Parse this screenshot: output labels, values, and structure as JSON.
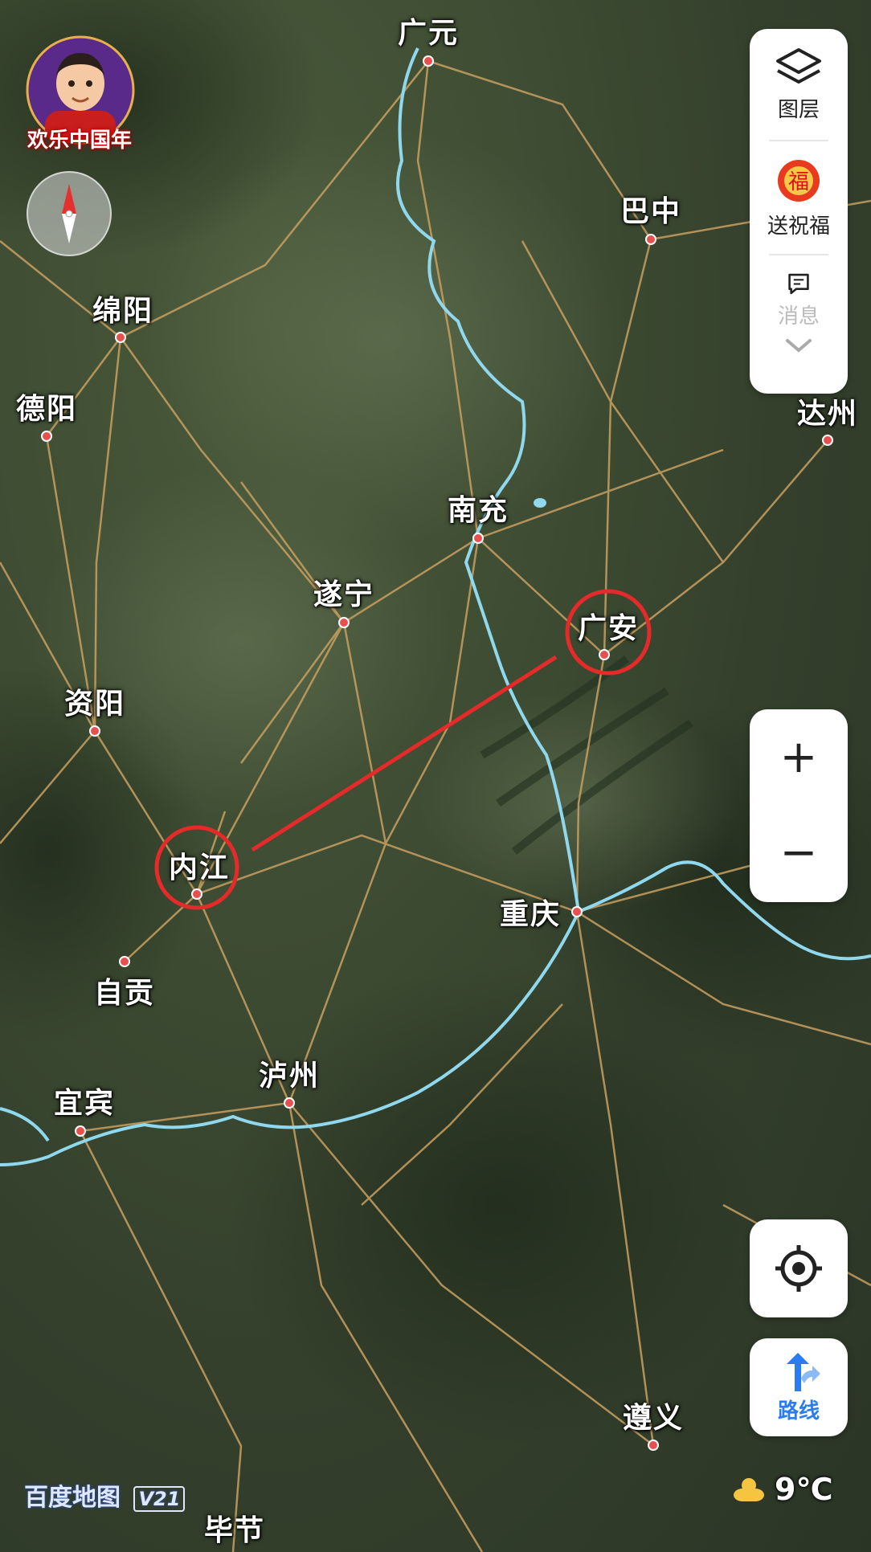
{
  "map": {
    "cities": [
      {
        "id": "guangyuan",
        "name": "广元"
      },
      {
        "id": "bazhong",
        "name": "巴中"
      },
      {
        "id": "mianyang",
        "name": "绵阳"
      },
      {
        "id": "deyang",
        "name": "德阳"
      },
      {
        "id": "dazhou",
        "name": "达州"
      },
      {
        "id": "nanchong",
        "name": "南充"
      },
      {
        "id": "suining",
        "name": "遂宁"
      },
      {
        "id": "guangan",
        "name": "广安"
      },
      {
        "id": "ziyang",
        "name": "资阳"
      },
      {
        "id": "neijiang",
        "name": "内江"
      },
      {
        "id": "chongqing",
        "name": "重庆"
      },
      {
        "id": "zigong",
        "name": "自贡"
      },
      {
        "id": "luzhou",
        "name": "泸州"
      },
      {
        "id": "yibin",
        "name": "宜宾"
      },
      {
        "id": "zunyi",
        "name": "遵义"
      },
      {
        "id": "bijie",
        "name": "毕节"
      }
    ],
    "annotation": {
      "circled": [
        "内江",
        "广安"
      ],
      "color": "#e52a2a"
    },
    "colors": {
      "terrain": "#3e4c33",
      "road": "#c9a061",
      "river": "#8fd8ee",
      "city_dot": "#e85050"
    }
  },
  "promo": {
    "label": "欢乐中国年",
    "icon": "avatar-icon"
  },
  "compass": {
    "icon": "compass-icon"
  },
  "toolbar": {
    "layers": {
      "label": "图层",
      "icon": "layers-icon"
    },
    "blessing": {
      "label": "送祝福",
      "icon": "fortune-icon"
    },
    "messages": {
      "label": "消息",
      "icon": "message-icon"
    },
    "expand_icon": "chevron-down-icon"
  },
  "zoom": {
    "in_label": "+",
    "out_label": "−"
  },
  "locate": {
    "icon": "crosshair-icon"
  },
  "route": {
    "label": "路线",
    "icon": "route-arrow-icon",
    "accent": "#2a7cf5"
  },
  "watermark": {
    "brand": "百度地图",
    "version": "V21"
  },
  "weather": {
    "temp": "9℃",
    "icon": "cloudy-icon"
  }
}
